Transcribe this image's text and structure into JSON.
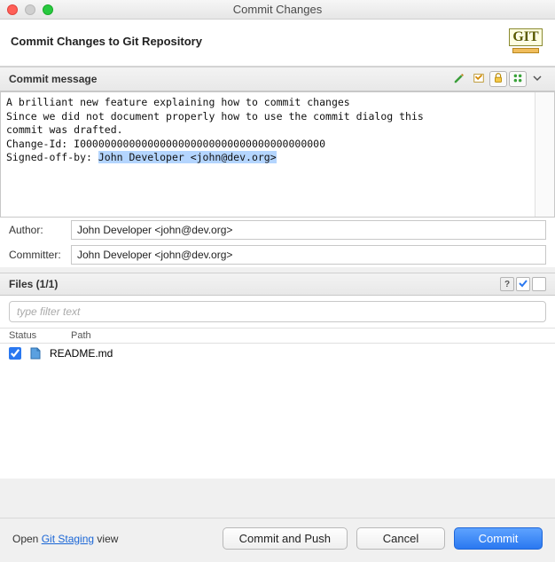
{
  "window": {
    "title": "Commit Changes"
  },
  "header": {
    "title": "Commit Changes to Git Repository"
  },
  "commitMessage": {
    "section_label": "Commit message",
    "line1": "A brilliant new feature explaining how to commit changes",
    "line2": "",
    "line3": "Since we did not document properly how to use the commit dialog this",
    "line4": "commit was drafted.",
    "line5": "",
    "line6": "Change-Id: I0000000000000000000000000000000000000000",
    "line7_prefix": "Signed-off-by: ",
    "line7_selected": "John Developer <john@dev.org>"
  },
  "author": {
    "label": "Author:",
    "value": "John Developer <john@dev.org>"
  },
  "committer": {
    "label": "Committer:",
    "value": "John Developer <john@dev.org>"
  },
  "files": {
    "section_label": "Files (1/1)",
    "filter_placeholder": "type filter text",
    "col_status": "Status",
    "col_path": "Path",
    "rows": [
      {
        "checked": true,
        "path": "README.md"
      }
    ]
  },
  "footer": {
    "open_text_pre": "Open ",
    "open_link": "Git Staging",
    "open_text_post": " view",
    "commit_push": "Commit and Push",
    "cancel": "Cancel",
    "commit": "Commit"
  },
  "icons": {
    "amend": "amend-icon",
    "signoff": "signoff-icon",
    "changeid": "changeid-icon",
    "lock": "lock-icon",
    "more": "chevron-down-icon"
  }
}
